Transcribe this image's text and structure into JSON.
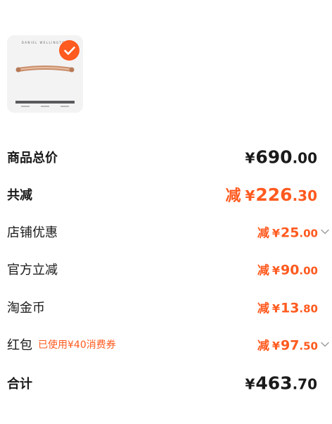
{
  "product": {
    "brand_text": "DANIEL WELLINGTON",
    "image_icon": "bracelet-thumbnail",
    "selected_icon": "check-icon",
    "accent_color": "#ff5a1f"
  },
  "summary": {
    "total_goods": {
      "label": "商品总价",
      "currency": "¥",
      "integer": "690",
      "decimal": ".00"
    },
    "total_discount": {
      "label": "共减",
      "prefix": "减",
      "currency": "¥",
      "integer": "226",
      "decimal": ".30"
    },
    "store_discount": {
      "label": "店铺优惠",
      "prefix": "减",
      "currency": "¥",
      "integer": "25",
      "decimal": ".00",
      "icon": "chevron-down-icon"
    },
    "official_discount": {
      "label": "官方立减",
      "prefix": "减",
      "currency": "¥",
      "integer": "90",
      "decimal": ".00"
    },
    "tao_coins": {
      "label": "淘金币",
      "prefix": "减",
      "currency": "¥",
      "integer": "13",
      "decimal": ".80"
    },
    "red_packet": {
      "label": "红包",
      "note": "已使用¥40消费券",
      "prefix": "减",
      "currency": "¥",
      "integer": "97",
      "decimal": ".50",
      "icon": "chevron-down-icon"
    },
    "grand_total": {
      "label": "合计",
      "currency": "¥",
      "integer": "463",
      "decimal": ".70"
    }
  }
}
